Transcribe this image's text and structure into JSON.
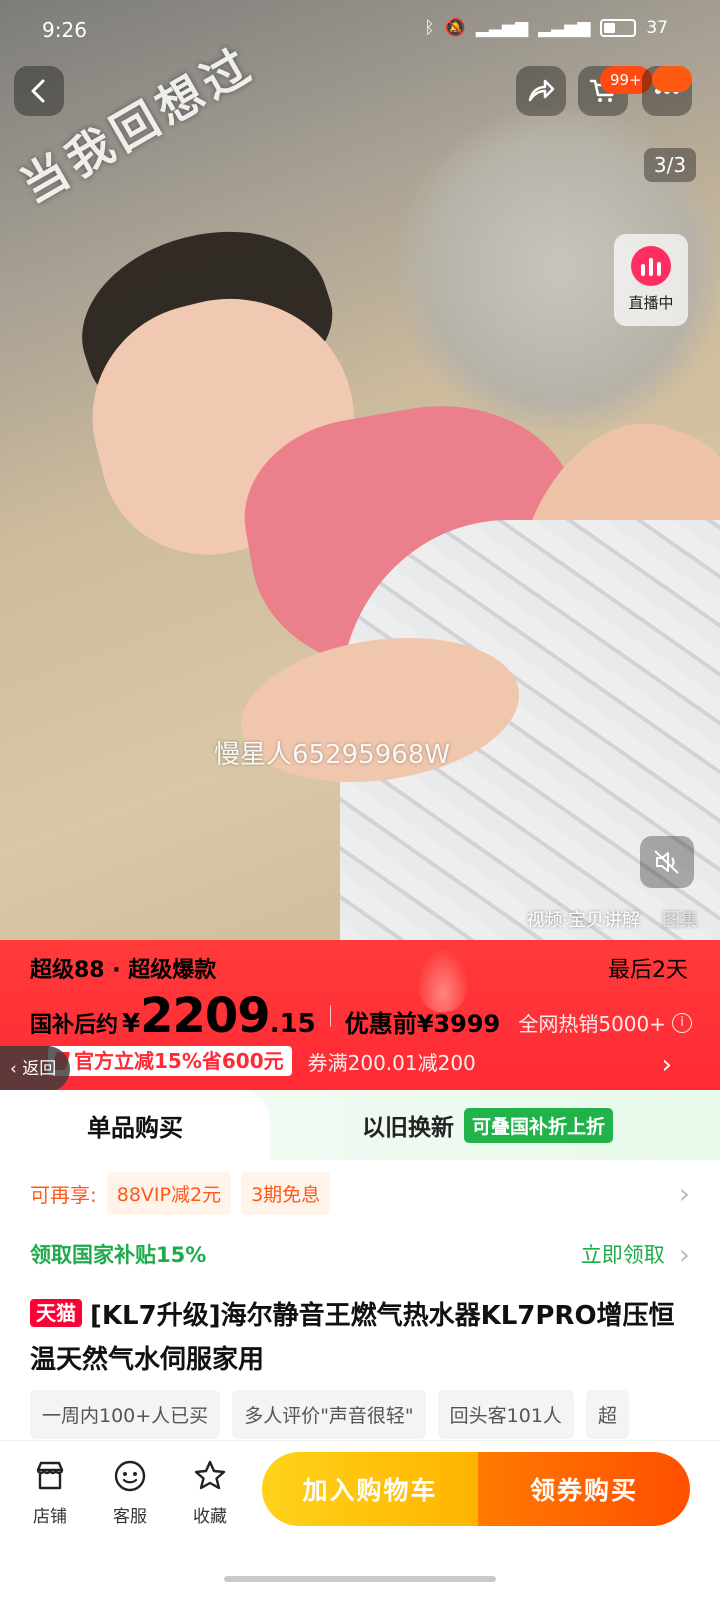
{
  "status_bar": {
    "time": "9:26",
    "battery": "37"
  },
  "media": {
    "overlay_caption": "当我回想过",
    "watermark": "慢星人65295968W",
    "counter": "3/3",
    "live_label": "直播中",
    "tabs": [
      "视频·宝贝讲解",
      "图集"
    ]
  },
  "header": {
    "cart_badge": "99+"
  },
  "price_banner": {
    "promo": "超级88 · 超级爆款",
    "days_left": "最后2天",
    "price_label": "国补后约",
    "currency": "¥",
    "price_int": "2209",
    "price_dec": ".15",
    "before_price": "优惠前¥3999",
    "hot_sales": "全网热销5000+",
    "official_tag": "官方立减15%省600元",
    "coupon": "券满200.01减200",
    "back_label": "返回"
  },
  "tabs": {
    "single": "单品购买",
    "tradein": "以旧换新",
    "tradein_tag": "可叠国补折上折"
  },
  "benefits": {
    "label": "可再享:",
    "chips": [
      "88VIP减2元",
      "3期免息"
    ]
  },
  "subsidy": {
    "label": "领取国家补贴15%",
    "cta": "立即领取"
  },
  "product": {
    "store_tag": "天猫",
    "title": "[KL7升级]海尔静音王燃气热水器KL7PRO增压恒温天然气水伺服家用"
  },
  "tags": [
    "一周内100+人已买",
    "多人评价\"声音很轻\"",
    "回头客101人",
    "超"
  ],
  "bottom_bar": {
    "shop": "店铺",
    "service": "客服",
    "favorite": "收藏",
    "add_to_cart": "加入购物车",
    "buy": "领券购买"
  },
  "colors": {
    "price_red": "#ff2a35",
    "green": "#21b24a",
    "tmall_red": "#ff0036",
    "cart_yellow": "#ffc107",
    "buy_orange": "#ff5a00"
  }
}
